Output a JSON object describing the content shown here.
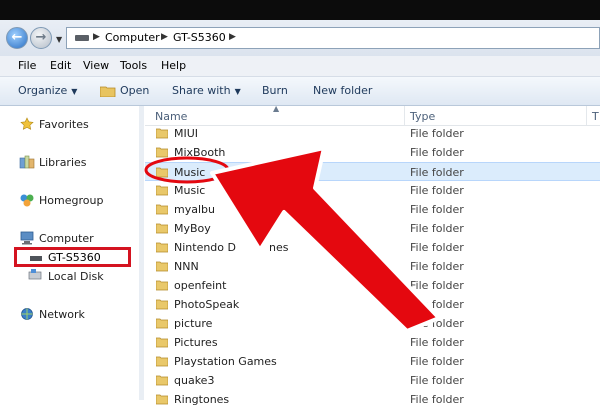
{
  "address": {
    "crumbs": [
      "Computer",
      "GT-S5360"
    ]
  },
  "menu": [
    "File",
    "Edit",
    "View",
    "Tools",
    "Help"
  ],
  "toolbar": {
    "organize": "Organize",
    "open": "Open",
    "share": "Share with",
    "burn": "Burn",
    "new_folder": "New folder"
  },
  "nav": {
    "favorites": "Favorites",
    "libraries": "Libraries",
    "homegroup": "Homegroup",
    "computer": "Computer",
    "device": "GT-S5360",
    "local_disk": "Local Disk",
    "network": "Network"
  },
  "columns": {
    "name": "Name",
    "type": "Type",
    "extra": "T"
  },
  "files": [
    {
      "name": "MIUI",
      "type": "File folder"
    },
    {
      "name": "MixBooth",
      "type": "File folder"
    },
    {
      "name": "Music",
      "type": "File folder"
    },
    {
      "name": "Music",
      "type": "File folder"
    },
    {
      "name": "myalbu",
      "type": "File folder"
    },
    {
      "name": "MyBoy",
      "type": "File folder"
    },
    {
      "name": "Nintendo D",
      "name_tail": "nes",
      "type": "File folder"
    },
    {
      "name": "NNN",
      "type": "File folder"
    },
    {
      "name": "openfeint",
      "type": "File folder"
    },
    {
      "name": "PhotoSpeak",
      "type": "File folder"
    },
    {
      "name": "picture",
      "type": "File folder"
    },
    {
      "name": "Pictures",
      "type": "File folder"
    },
    {
      "name": "Playstation Games",
      "type": "File folder"
    },
    {
      "name": "quake3",
      "type": "File folder"
    },
    {
      "name": "Ringtones",
      "type": "File folder"
    }
  ],
  "colors": {
    "annotation": "#e4080f",
    "selection": "#dbecfc"
  }
}
